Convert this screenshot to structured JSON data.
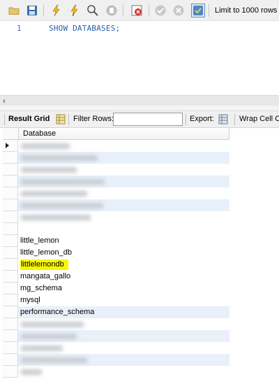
{
  "toolbar": {
    "icons": [
      "open-folder-icon",
      "save-icon",
      "execute-icon",
      "execute-current-icon",
      "explain-icon",
      "stop-icon",
      "toggle-error-icon",
      "commit-icon",
      "rollback-icon",
      "autocommit-icon"
    ],
    "limit_label": "Limit to 1000 rows"
  },
  "editor": {
    "line_number": "1",
    "code": "SHOW DATABASES;"
  },
  "results_toolbar": {
    "result_grid_label": "Result Grid",
    "filter_rows_label": "Filter Rows:",
    "filter_value": "",
    "export_label": "Export:",
    "wrap_label": "Wrap Cell Co"
  },
  "grid": {
    "column_header": "Database",
    "visible_rows": [
      {
        "value": "little_lemon"
      },
      {
        "value": "little_lemon_db"
      },
      {
        "value": "littlelemondb",
        "highlighted": true
      },
      {
        "value": "mangata_gallo"
      },
      {
        "value": "mg_schema"
      },
      {
        "value": "mysql"
      },
      {
        "value": "performance_schema"
      }
    ]
  },
  "colors": {
    "highlight": "#f7f700",
    "alt_row": "#e8f0fa",
    "code_blue": "#2a5db0"
  }
}
